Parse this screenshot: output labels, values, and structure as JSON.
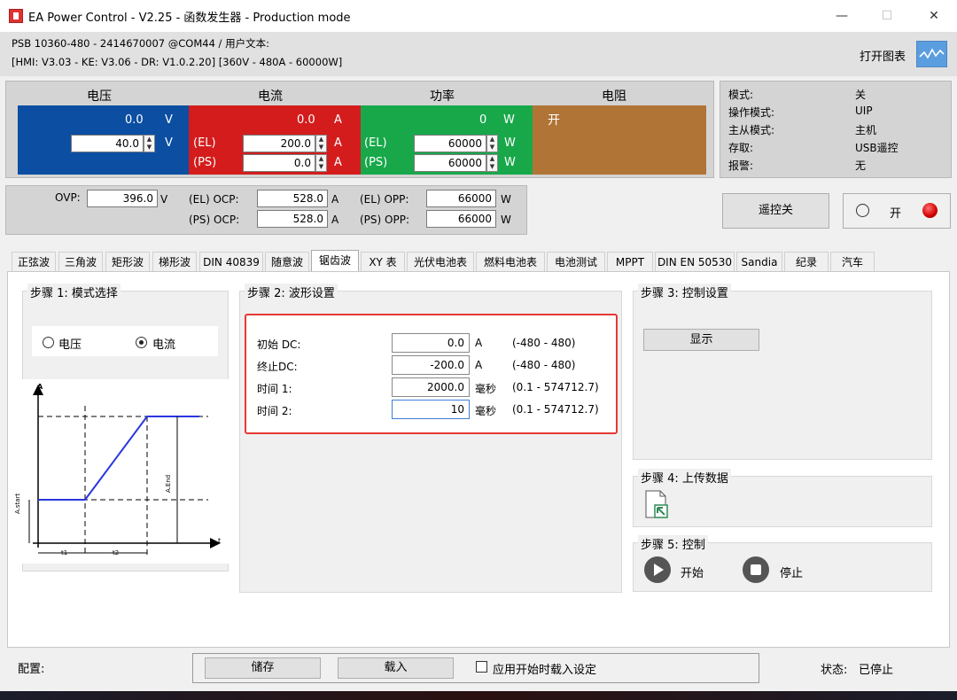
{
  "window": {
    "title": "EA Power Control - V2.25 - 函数发生器 - Production mode",
    "min_glyph": "—",
    "max_glyph": "☐",
    "close_glyph": "✕"
  },
  "device": {
    "line1": "PSB 10360-480 - 2414670007 @COM44 / 用户文本:",
    "line2": "[HMI: V3.03 - KE: V3.06 - DR: V1.0.2.20] [360V - 480A - 60000W]",
    "open_chart_label": "打开图表"
  },
  "display": {
    "voltage": {
      "header": "电压",
      "actual": "0.0",
      "unit": "V",
      "set": "40.0",
      "color": "#0b4ea2"
    },
    "current": {
      "header": "电流",
      "actual": "0.0",
      "unit": "A",
      "el_label": "(EL)",
      "ps_label": "(PS)",
      "el_set": "200.0",
      "ps_set": "0.0",
      "color": "#d41c1c"
    },
    "power": {
      "header": "功率",
      "actual": "0",
      "unit": "W",
      "el_label": "(EL)",
      "ps_label": "(PS)",
      "el_set": "60000",
      "ps_set": "60000",
      "color": "#18a84a"
    },
    "resistance": {
      "header": "电阻",
      "state": "开",
      "color": "#b07436"
    }
  },
  "status": {
    "rows": [
      {
        "label": "模式:",
        "value": "关"
      },
      {
        "label": "操作模式:",
        "value": "UIP"
      },
      {
        "label": "主从模式:",
        "value": "主机"
      },
      {
        "label": "存取:",
        "value": "USB遥控"
      },
      {
        "label": "报警:",
        "value": "无"
      }
    ]
  },
  "protection": {
    "ovp_label": "OVP:",
    "ovp_value": "396.0",
    "ovp_unit": "V",
    "el_ocp_label": "(EL) OCP:",
    "el_ocp_value": "528.0",
    "ocp_unit": "A",
    "ps_ocp_label": "(PS) OCP:",
    "ps_ocp_value": "528.0",
    "el_opp_label": "(EL) OPP:",
    "el_opp_value": "66000",
    "opp_unit": "W",
    "ps_opp_label": "(PS) OPP:",
    "ps_opp_value": "66000"
  },
  "remote": {
    "button_label": "遥控关",
    "onoff_label": "开"
  },
  "tabs": [
    {
      "label": "正弦波",
      "active": false
    },
    {
      "label": "三角波",
      "active": false
    },
    {
      "label": "矩形波",
      "active": false
    },
    {
      "label": "梯形波",
      "active": false
    },
    {
      "label": "DIN 40839",
      "active": false
    },
    {
      "label": "随意波",
      "active": false
    },
    {
      "label": "锯齿波",
      "active": true
    },
    {
      "label": "XY 表",
      "active": false
    },
    {
      "label": "光伏电池表",
      "active": false
    },
    {
      "label": "燃料电池表",
      "active": false
    },
    {
      "label": "电池测试",
      "active": false
    },
    {
      "label": "MPPT",
      "active": false
    },
    {
      "label": "DIN EN 50530",
      "active": false
    },
    {
      "label": "Sandia",
      "active": false
    },
    {
      "label": "纪录",
      "active": false
    },
    {
      "label": "汽车",
      "active": false
    }
  ],
  "step1": {
    "title": "步骤 1: 模式选择",
    "option_voltage": "电压",
    "option_current": "电流",
    "selected": "电流",
    "diagram": {
      "y_axis": "A",
      "x_axis": "t",
      "start_label": "A.start",
      "end_label": "A.End",
      "t1": "t1",
      "t2": "t2"
    }
  },
  "step2": {
    "title": "步骤 2: 波形设置",
    "rows": [
      {
        "label": "初始 DC:",
        "value": "0.0",
        "unit": "A",
        "range": "(-480 - 480)"
      },
      {
        "label": "终止DC:",
        "value": "-200.0",
        "unit": "A",
        "range": "(-480 - 480)"
      },
      {
        "label": "时间 1:",
        "value": "2000.0",
        "unit": "毫秒",
        "range": "(0.1 - 574712.7)"
      },
      {
        "label": "时间 2:",
        "value": "10",
        "unit": "毫秒",
        "range": "(0.1 - 574712.7)"
      }
    ]
  },
  "step3": {
    "title": "步骤 3: 控制设置",
    "show_button": "显示"
  },
  "step4": {
    "title": "步骤 4: 上传数据"
  },
  "step5": {
    "title": "步骤 5: 控制",
    "start_label": "开始",
    "stop_label": "停止"
  },
  "bottom": {
    "config_label": "配置:",
    "save_label": "储存",
    "load_label": "载入",
    "apply_on_start_label": "应用开始时载入设定",
    "status_label": "状态:",
    "status_value": "已停止"
  }
}
